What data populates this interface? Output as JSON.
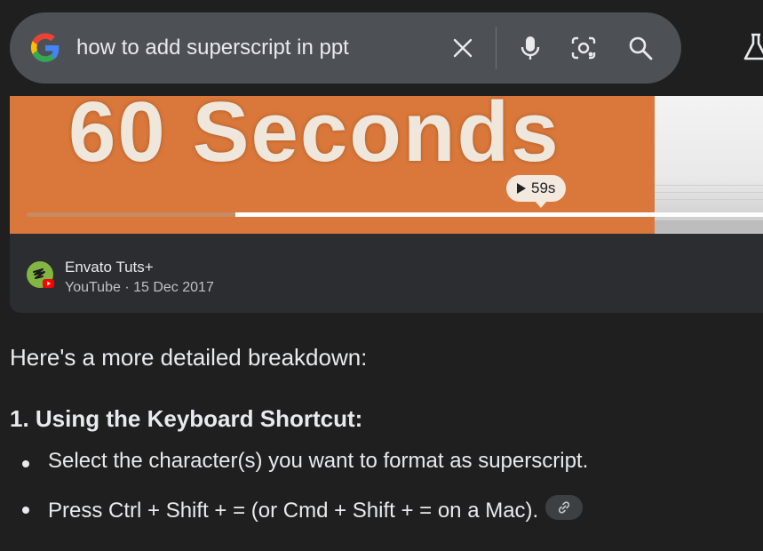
{
  "search": {
    "query": "how to add superscript in ppt",
    "icons": [
      "google-g-logo",
      "close-icon",
      "mic-icon",
      "camera-lens-icon",
      "search-icon",
      "labs-flask-icon"
    ]
  },
  "video": {
    "thumbnail_text": "60 Seconds",
    "duration": "59s",
    "progress_fraction": 0.28,
    "channel_name": "Envato Tuts+",
    "platform": "YouTube",
    "separator": "·",
    "date": "15 Dec 2017"
  },
  "answer": {
    "intro": "Here's a more detailed breakdown:",
    "section_heading": "1. Using the Keyboard Shortcut:",
    "bullets": [
      "Select the character(s) you want to format as superscript.",
      "Press Ctrl + Shift + = (or Cmd + Shift + = on a Mac)."
    ],
    "link_icon": "link-icon"
  },
  "colors": {
    "page_bg": "#1f1f1f",
    "searchbar_bg": "#4d5156",
    "card_bg": "#2c2d30",
    "thumbnail_orange": "#d9783a",
    "text_primary": "#e8eaed",
    "text_secondary": "#bdc1c6"
  }
}
